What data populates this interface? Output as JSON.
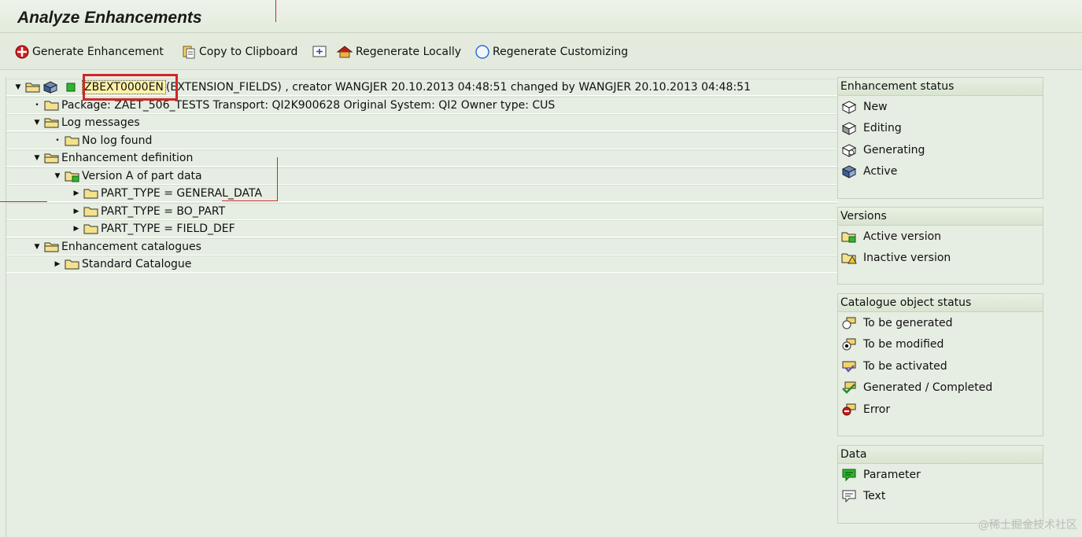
{
  "title": "Analyze Enhancements",
  "toolbar": {
    "generate": "Generate Enhancement",
    "copy": "Copy to Clipboard",
    "regen_local": "Regenerate Locally",
    "regen_custom": "Regenerate Customizing"
  },
  "tree": {
    "root_key": "ZBEXT0000EN",
    "root_rest": " (EXTENSION_FIELDS) , creator WANGJER 20.10.2013 04:48:51 changed by WANGJER 20.10.2013 04:48:51",
    "package": "Package: ZAET_506_TESTS Transport: QI2K900628 Original System: QI2 Owner type: CUS",
    "log_messages": "Log messages",
    "no_log": "No log found",
    "enh_def": "Enhancement definition",
    "version_a": "Version A of part data",
    "part_general": "PART_TYPE = GENERAL_DATA",
    "part_bo": "PART_TYPE = BO_PART",
    "part_field": "PART_TYPE = FIELD_DEF",
    "enh_cat": "Enhancement catalogues",
    "std_cat": "Standard Catalogue"
  },
  "legend": {
    "status_head": "Enhancement status",
    "status_items": [
      "New",
      "Editing",
      "Generating",
      "Active"
    ],
    "versions_head": "Versions",
    "versions_items": [
      "Active version",
      "Inactive version"
    ],
    "catalogue_head": "Catalogue object status",
    "catalogue_items": [
      "To be generated",
      "To be modified",
      "To be activated",
      "Generated / Completed",
      "Error"
    ],
    "data_head": "Data",
    "data_items": [
      "Parameter",
      "Text"
    ]
  },
  "watermark": "@稀土掘金技术社区",
  "colors": {
    "accent_red": "#d0262b",
    "background": "#e6ede2",
    "highlight": "#fff2a8"
  }
}
